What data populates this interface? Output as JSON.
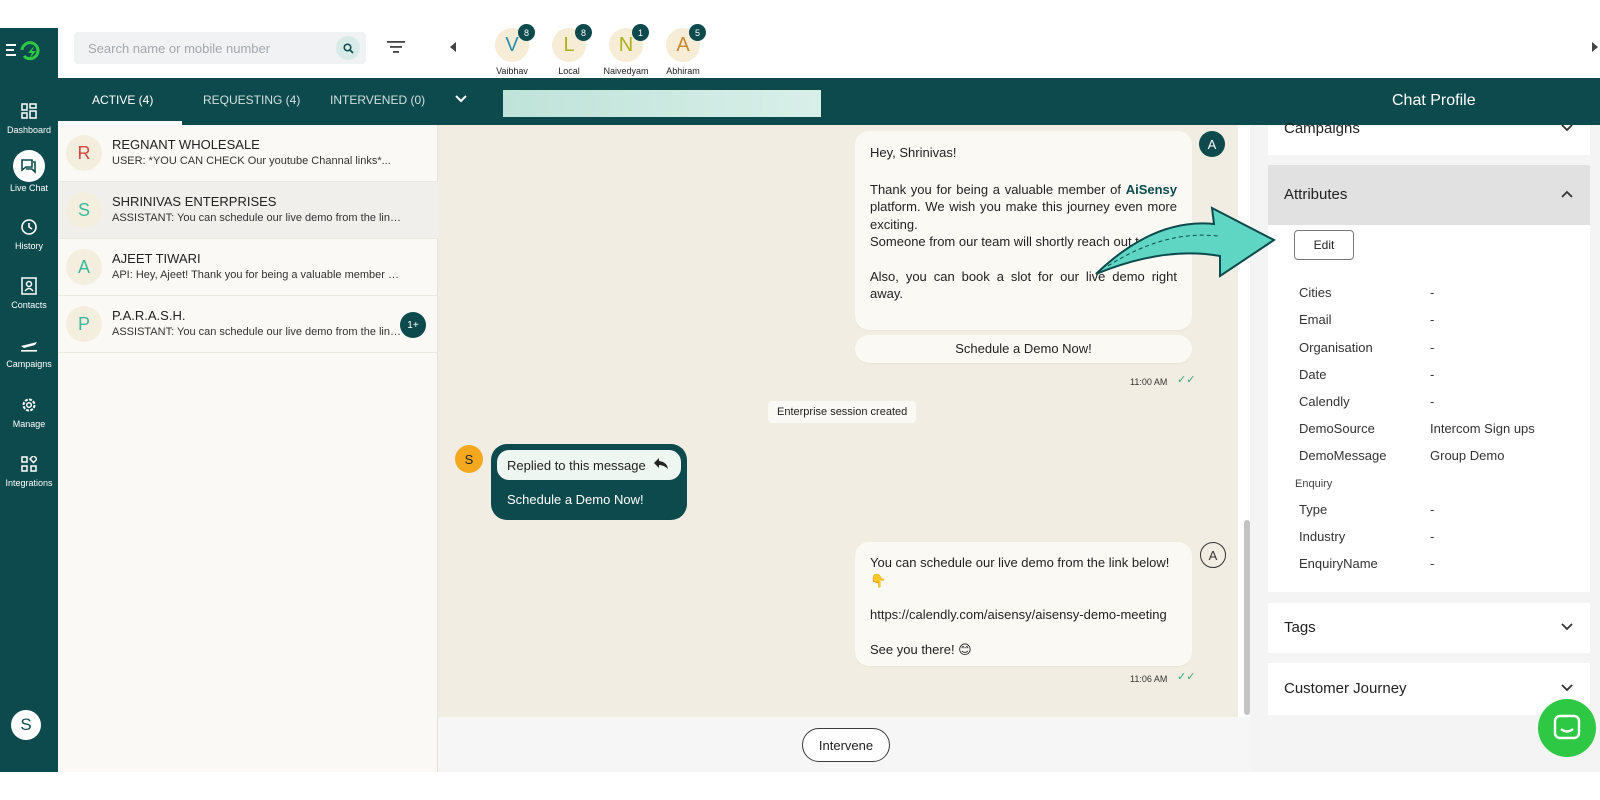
{
  "colors": {
    "brand_dark": "#0d4a4d",
    "accent_green": "#2ec844",
    "chat_bg": "#f2ede2",
    "arrow_fill": "#5fd6c3"
  },
  "nav": {
    "items": [
      {
        "label": "Dashboard",
        "icon": "dashboard-icon"
      },
      {
        "label": "Live Chat",
        "icon": "chat-icon"
      },
      {
        "label": "History",
        "icon": "history-icon"
      },
      {
        "label": "Contacts",
        "icon": "contacts-icon"
      },
      {
        "label": "Campaigns",
        "icon": "plane-icon"
      },
      {
        "label": "Manage",
        "icon": "gear-icon"
      },
      {
        "label": "Integrations",
        "icon": "integrations-icon"
      }
    ],
    "user_initial": "S"
  },
  "search": {
    "placeholder": "Search name or mobile number"
  },
  "agents": [
    {
      "initial": "V",
      "name": "Vaibhav",
      "count": "8",
      "color": "#2a8fb0"
    },
    {
      "initial": "L",
      "name": "Local",
      "count": "8",
      "color": "#a9b21a"
    },
    {
      "initial": "N",
      "name": "Naivedyam",
      "count": "1",
      "color": "#a9b21a"
    },
    {
      "initial": "A",
      "name": "Abhiram",
      "count": "5",
      "color": "#c98a2e"
    }
  ],
  "tabs": [
    {
      "label": "ACTIVE (4)"
    },
    {
      "label": "REQUESTING (4)"
    },
    {
      "label": "INTERVENED (0)"
    }
  ],
  "profile_title": "Chat Profile",
  "chats": [
    {
      "initial": "R",
      "name": "REGNANT WHOLESALE",
      "preview": "USER: *YOU CAN CHECK Our youtube Channal links*...",
      "color": "#d4473d"
    },
    {
      "initial": "S",
      "name": "SHRINIVAS ENTERPRISES",
      "preview": "ASSISTANT: You can schedule our live demo from the link below!",
      "color": "#3bb99c"
    },
    {
      "initial": "A",
      "name": "AJEET TIWARI",
      "preview": "API: Hey, Ajeet! Thank you for being a valuable member of AiSensy",
      "color": "#3bb99c"
    },
    {
      "initial": "P",
      "name": "P.A.R.A.S.H.",
      "preview": "ASSISTANT: You can schedule our live demo from the link below!",
      "color": "#3bb99c",
      "unread": "1+"
    }
  ],
  "messages": {
    "m1": {
      "greeting": "Hey, Shrinivas!",
      "p1_before": "Thank you for being a valuable member of ",
      "brand": "AiSensy",
      "p1_after": " platform. We wish you make this journey even more exciting.",
      "p2": "Someone from our team will shortly reach out to you.",
      "p3": "Also, you can book a slot for our live demo right away.",
      "button": "Schedule a Demo Now!",
      "time": "11:00 AM",
      "avatar": "A"
    },
    "system": "Enterprise session created",
    "reply": {
      "avatar": "S",
      "quoted": "Replied to this message",
      "text": "Schedule a Demo Now!"
    },
    "m2": {
      "line1": "You can schedule our live demo from the link below!",
      "emoji1": "👇",
      "link": "https://calendly.com/aisensy/aisensy-demo-meeting",
      "line3": "See you there! 😊",
      "time": "11:06 AM",
      "avatar": "A"
    }
  },
  "intervene_label": "Intervene",
  "profile": {
    "campaigns": "Campaigns",
    "attributes": "Attributes",
    "edit": "Edit",
    "attrs": [
      {
        "label": "Cities",
        "value": "-"
      },
      {
        "label": "Email",
        "value": "-"
      },
      {
        "label": "Organisation",
        "value": "-"
      },
      {
        "label": "Date",
        "value": "-"
      },
      {
        "label": "Calendly",
        "value": "-"
      },
      {
        "label": "DemoSource",
        "value": "Intercom Sign ups"
      },
      {
        "label": "DemoMessage",
        "value": "Group Demo"
      }
    ],
    "enquiry_heading": "Enquiry",
    "enquiry": [
      {
        "label": "Type",
        "value": "-"
      },
      {
        "label": "Industry",
        "value": "-"
      },
      {
        "label": "EnquiryName",
        "value": "-"
      }
    ],
    "tags": "Tags",
    "journey": "Customer Journey"
  }
}
